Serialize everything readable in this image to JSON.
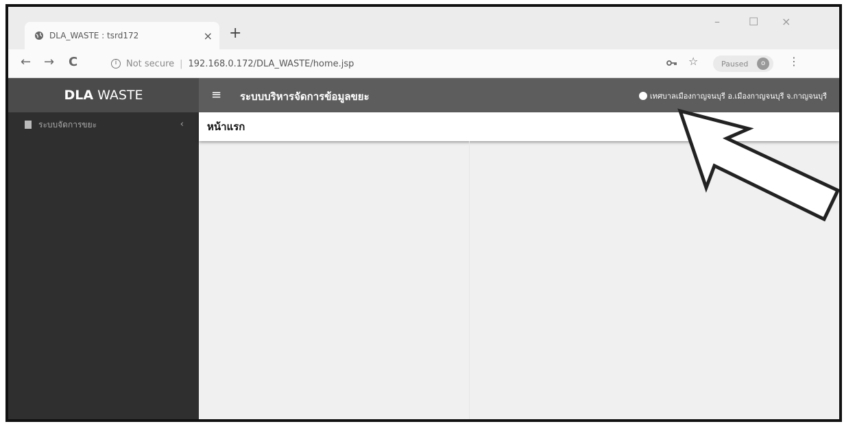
{
  "browser": {
    "tab_title": "DLA_WASTE : tsrd172",
    "tab_close": "×",
    "new_tab": "+",
    "window_controls": {
      "minimize": "–",
      "maximize": "☐",
      "close": "×"
    },
    "nav": {
      "back": "←",
      "forward": "→",
      "reload": "C"
    },
    "security_label": "Not secure",
    "security_separator": "|",
    "url": "192.168.0.172/DLA_WASTE/home.jsp",
    "key_icon": "key-icon",
    "star": "☆",
    "profile_status": "Paused",
    "profile_initial": "o",
    "menu": "⋮"
  },
  "app": {
    "brand": {
      "bold": "DLA",
      "rest": "WASTE"
    },
    "hamburger": "≡",
    "system_title": "ระบบบริหารจัดการข้อมูลขยะ",
    "user_label": "เทศบาลเมืองกาญจนบุรี อ.เมืองกาญจนบุรี จ.กาญจนบุรี",
    "sidebar": {
      "items": [
        {
          "label": "ระบบจัดการขยะ",
          "chevron": "‹"
        }
      ]
    },
    "page_title": "หน้าแรก"
  },
  "colors": {
    "brand_bg": "#4b4b4b",
    "topnav_bg": "#5d5d5d",
    "sidebar_bg": "#2f2f2f",
    "content_bg": "#f0f0f0"
  }
}
